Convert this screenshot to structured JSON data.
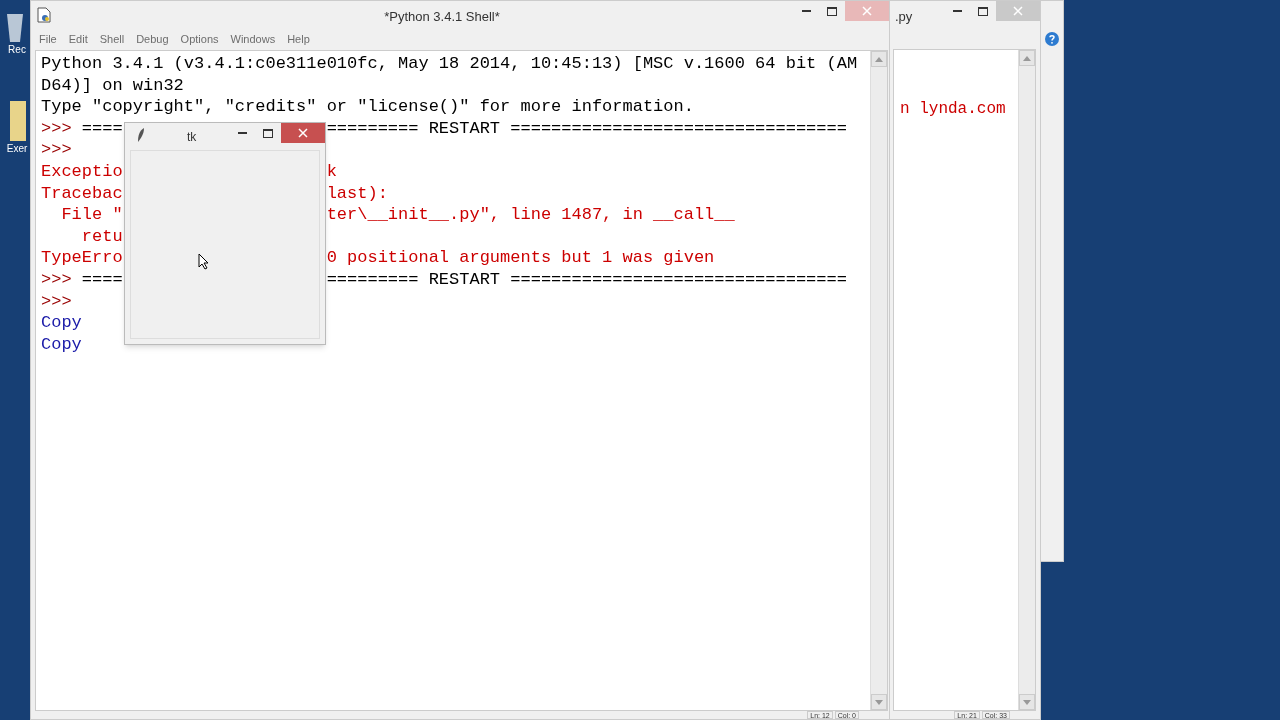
{
  "desktop": {
    "icons": [
      {
        "kind": "bin",
        "label": "Rec"
      },
      {
        "kind": "folder",
        "label": "Exer"
      }
    ]
  },
  "shell_window": {
    "title": "*Python 3.4.1 Shell*",
    "menu": [
      "File",
      "Edit",
      "Shell",
      "Debug",
      "Options",
      "Windows",
      "Help"
    ],
    "lines": [
      {
        "left": [
          {
            "kind": "plain",
            "text": "Python 3.4.1 (v3.4.1:c0e311e010fc, May 18 2014, 10:45:13) [MSC v.1600 64 bit (AM"
          }
        ]
      },
      {
        "left": [
          {
            "kind": "plain",
            "text": "D64)] on win32"
          }
        ]
      },
      {
        "left": [
          {
            "kind": "plain",
            "text": "Type \"copyright\", \"credits\" or \"license()\" for more information."
          }
        ]
      },
      {
        "left": [
          {
            "kind": "prompt",
            "text": ">>>"
          },
          {
            "kind": "plain",
            "text": " ===="
          }
        ],
        "right": [
          {
            "kind": "plain",
            "text": "========= RESTART ================================="
          }
        ]
      },
      {
        "left": [
          {
            "kind": "prompt",
            "text": ">>>"
          }
        ]
      },
      {
        "left": [
          {
            "kind": "error",
            "text": "Exceptio"
          }
        ],
        "right": [
          {
            "kind": "error",
            "text": "k"
          }
        ]
      },
      {
        "left": [
          {
            "kind": "error",
            "text": "Tracebac"
          }
        ],
        "right": [
          {
            "kind": "error",
            "text": "last):"
          }
        ]
      },
      {
        "left": [
          {
            "kind": "error",
            "text": "  File \""
          }
        ],
        "right": [
          {
            "kind": "error",
            "text": "ter\\__init__.py\", line 1487, in __call__"
          }
        ]
      },
      {
        "left": [
          {
            "kind": "error",
            "text": "    retu"
          }
        ]
      },
      {
        "left": [
          {
            "kind": "error",
            "text": "TypeErro"
          }
        ],
        "right": [
          {
            "kind": "error",
            "text": "0 positional arguments but 1 was given"
          }
        ]
      },
      {
        "left": [
          {
            "kind": "prompt",
            "text": ">>>"
          },
          {
            "kind": "plain",
            "text": " ===="
          }
        ],
        "right": [
          {
            "kind": "plain",
            "text": "========= RESTART ================================="
          }
        ]
      },
      {
        "left": [
          {
            "kind": "prompt",
            "text": ">>>"
          }
        ]
      },
      {
        "left": [
          {
            "kind": "output",
            "text": "Copy"
          }
        ]
      },
      {
        "left": [
          {
            "kind": "output",
            "text": "Copy"
          }
        ]
      }
    ],
    "status": [
      "Ln: 12",
      "Col: 0"
    ]
  },
  "tk_window": {
    "title": "tk"
  },
  "editor_window": {
    "title": ".py",
    "text": "n lynda.com",
    "status": [
      "Ln: 21",
      "Col: 33"
    ]
  }
}
